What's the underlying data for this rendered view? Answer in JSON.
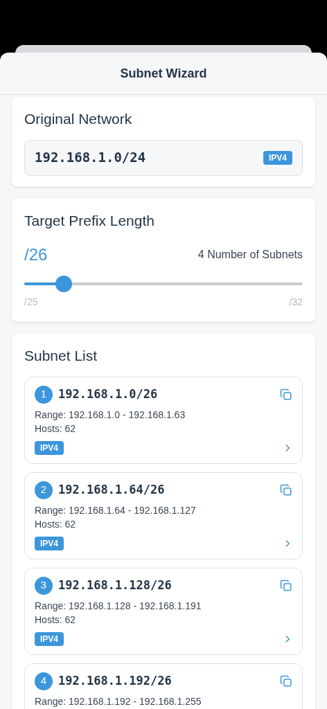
{
  "header": {
    "title": "Subnet Wizard"
  },
  "original_network": {
    "title": "Original Network",
    "value": "192.168.1.0/24",
    "badge": "IPV4"
  },
  "prefix": {
    "title": "Target Prefix Length",
    "value": "/26",
    "subnets": "4 Number of Subnets",
    "level": 0.143,
    "min_label": "/25",
    "max_label": "/32"
  },
  "subnet_list": {
    "title": "Subnet List",
    "items": [
      {
        "index": "1",
        "cidr": "192.168.1.0/26",
        "range": "Range: 192.168.1.0 - 192.168.1.63",
        "hosts": "Hosts: 62",
        "badge": "IPV4"
      },
      {
        "index": "2",
        "cidr": "192.168.1.64/26",
        "range": "Range: 192.168.1.64 - 192.168.1.127",
        "hosts": "Hosts: 62",
        "badge": "IPV4"
      },
      {
        "index": "3",
        "cidr": "192.168.1.128/26",
        "range": "Range: 192.168.1.128 - 192.168.1.191",
        "hosts": "Hosts: 62",
        "badge": "IPV4"
      },
      {
        "index": "4",
        "cidr": "192.168.1.192/26",
        "range": "Range: 192.168.1.192 - 192.168.1.255"
      }
    ]
  }
}
